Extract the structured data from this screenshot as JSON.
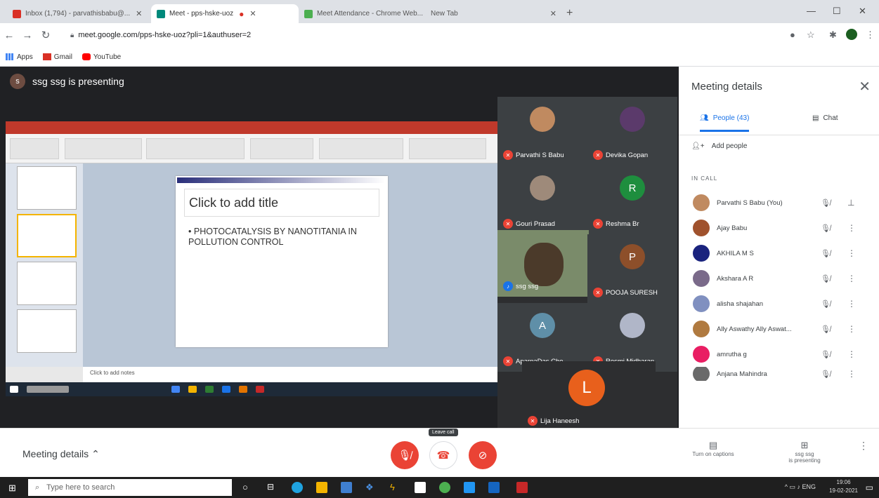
{
  "browser": {
    "tabs": [
      {
        "label": "Inbox (1,794) - parvathisbabu@...",
        "color": "#d93025"
      },
      {
        "label": "Meet - pps-hske-uoz",
        "color": "#00897b",
        "recording": true
      },
      {
        "label": "Meet Attendance - Chrome Web...",
        "color": "#4caf50"
      },
      {
        "label": "New Tab",
        "color": "#9e9e9e"
      }
    ],
    "url": "meet.google.com/pps-hske-uoz?pli=1&authuser=2",
    "bookmarks": [
      "Apps",
      "Gmail",
      "YouTube"
    ]
  },
  "meeting": {
    "presenter_initial": "s",
    "presenter_text": "ssg ssg is presenting",
    "slide": {
      "title_placeholder": "Click to add title",
      "bullet": "PHOTOCATALYSIS BY NANOTITANIA IN POLLUTION CONTROL",
      "notes": "Click to add notes"
    },
    "tiles": [
      {
        "name": "Parvathi S Babu",
        "color": "#c08a60"
      },
      {
        "name": "Devika Gopan",
        "color": "#5b3a6b"
      },
      {
        "name": "Gouri Prasad",
        "color": "#9e8a7a"
      },
      {
        "name": "Reshma Br",
        "initial": "R",
        "color": "#1e8e3e"
      },
      {
        "name": "ssg ssg"
      },
      {
        "name": "POOJA SURESH",
        "initial": "P",
        "color": "#8d4f2a"
      },
      {
        "name": "AparnaDas Che...",
        "initial": "A",
        "color": "#5f8fa8"
      },
      {
        "name": "Resmi Midharan",
        "color": "#b0b6c8"
      }
    ],
    "lija": {
      "name": "Lija Haneesh",
      "initial": "L"
    }
  },
  "panel": {
    "title": "Meeting details",
    "people_tab": "People (43)",
    "chat_tab": "Chat",
    "add_people": "Add people",
    "in_call": "IN CALL",
    "people": [
      {
        "name": "Parvathi S Babu (You)",
        "color": "#c08a60"
      },
      {
        "name": "Ajay Babu",
        "color": "#a0522d"
      },
      {
        "name": "AKHILA M S",
        "color": "#1a237e"
      },
      {
        "name": "Akshara A R",
        "color": "#7a6a8a"
      },
      {
        "name": "alisha shajahan",
        "color": "#8090c0"
      },
      {
        "name": "Ally Aswathy Ally Aswat...",
        "color": "#b07a40"
      },
      {
        "name": "amrutha g",
        "color": "#e91e63"
      },
      {
        "name": "Anjana Mahindra",
        "color": "#6a6a6a"
      }
    ]
  },
  "bottom": {
    "meeting_details": "Meeting details",
    "leave_tip": "Leave call",
    "captions": "Turn on captions",
    "presenting_l1": "ssg ssg",
    "presenting_l2": "is presenting"
  },
  "taskbar": {
    "search": "Type here to search",
    "lang": "ENG",
    "time": "19:06",
    "date": "19-02-2021"
  },
  "colors": {
    "red": "#ea4335",
    "blue": "#1a73e8"
  }
}
